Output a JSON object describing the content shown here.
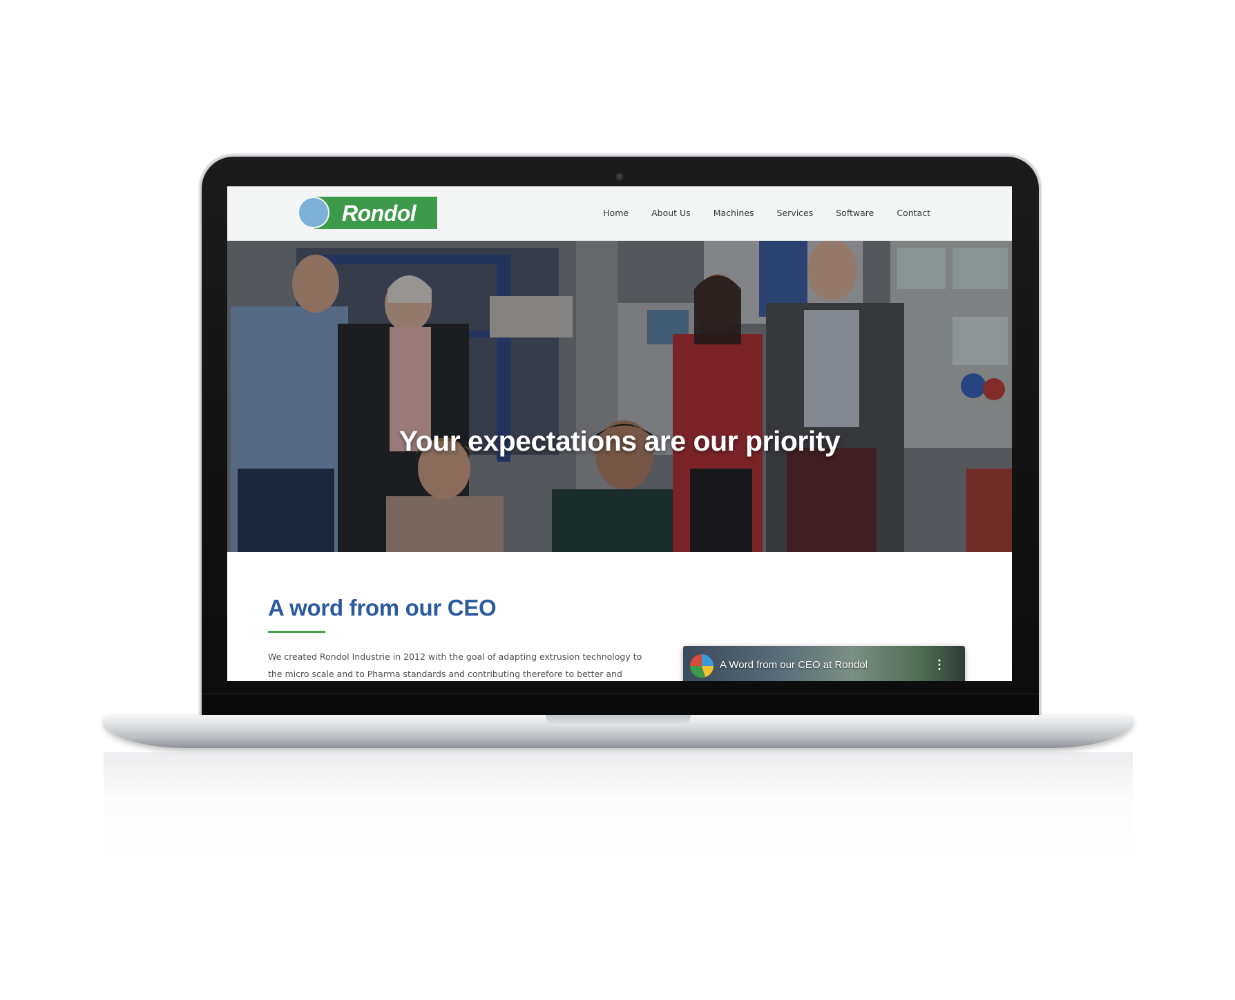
{
  "brand": {
    "logo_text": "Rondol",
    "green": "#3d9a4a",
    "blue": "#7cb0d6"
  },
  "nav": {
    "items": [
      {
        "label": "Home"
      },
      {
        "label": "About Us"
      },
      {
        "label": "Machines"
      },
      {
        "label": "Services"
      },
      {
        "label": "Software"
      },
      {
        "label": "Contact"
      }
    ]
  },
  "hero": {
    "title": "Your expectations are our priority"
  },
  "ceo": {
    "title": "A word from our CEO",
    "text": "We created Rondol Industrie in 2012 with the goal of adapting extrusion technology to the micro scale and to Pharma standards and contributing therefore to better and cheaper",
    "accent": "#2b5aa0",
    "underline_color": "#46a24f"
  },
  "video": {
    "title": "A Word from our CEO at Rondol",
    "menu_icon": "more-vertical-icon"
  }
}
